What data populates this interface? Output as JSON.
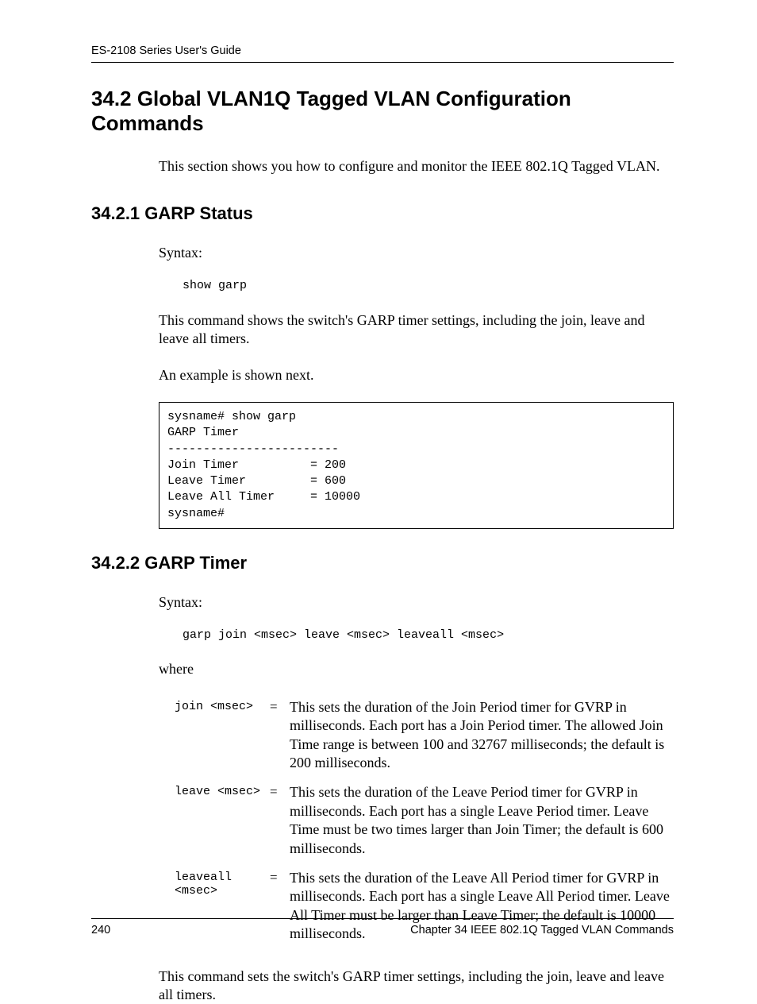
{
  "header": {
    "guide": "ES-2108 Series User's Guide"
  },
  "section": {
    "h2": "34.2  Global VLAN1Q Tagged VLAN Configuration Commands",
    "intro": "This section shows you how to configure and monitor the IEEE 802.1Q Tagged VLAN."
  },
  "s1": {
    "h3": "34.2.1  GARP Status",
    "syntax_label": "Syntax:",
    "syntax_cmd": "show garp",
    "desc": "This command shows the switch's GARP timer settings, including the join, leave and leave all timers.",
    "example_label": "An example is shown next.",
    "code": "sysname# show garp\nGARP Timer\n------------------------\nJoin Timer          = 200\nLeave Timer         = 600\nLeave All Timer     = 10000\nsysname#"
  },
  "s2": {
    "h3": "34.2.2  GARP Timer",
    "syntax_label": "Syntax:",
    "syntax_cmd": "garp join <msec> leave <msec> leaveall <msec>",
    "where_label": "where",
    "params": {
      "p1_name": "join <msec>",
      "p1_desc": "This sets the duration of the Join Period timer for GVRP in milliseconds. Each port has a Join Period timer. The allowed Join Time range is between 100 and 32767 milliseconds; the default is 200 milliseconds.",
      "p2_name": "leave <msec>",
      "p2_desc": "This sets the duration of the Leave Period timer for GVRP in milliseconds. Each port has a single Leave Period timer. Leave Time must be two times larger than Join Timer; the default is 600 milliseconds.",
      "p3_name": "leaveall <msec>",
      "p3_desc": "This sets the duration of the Leave All Period timer for GVRP in milliseconds. Each port has a single Leave All Period timer. Leave All Timer must be larger than Leave Timer; the default is 10000 milliseconds."
    },
    "final": "This command sets the switch's GARP timer settings, including the join, leave and leave all timers."
  },
  "eq": "=",
  "footer": {
    "page": "240",
    "chapter": "Chapter 34 IEEE 802.1Q Tagged VLAN Commands"
  }
}
